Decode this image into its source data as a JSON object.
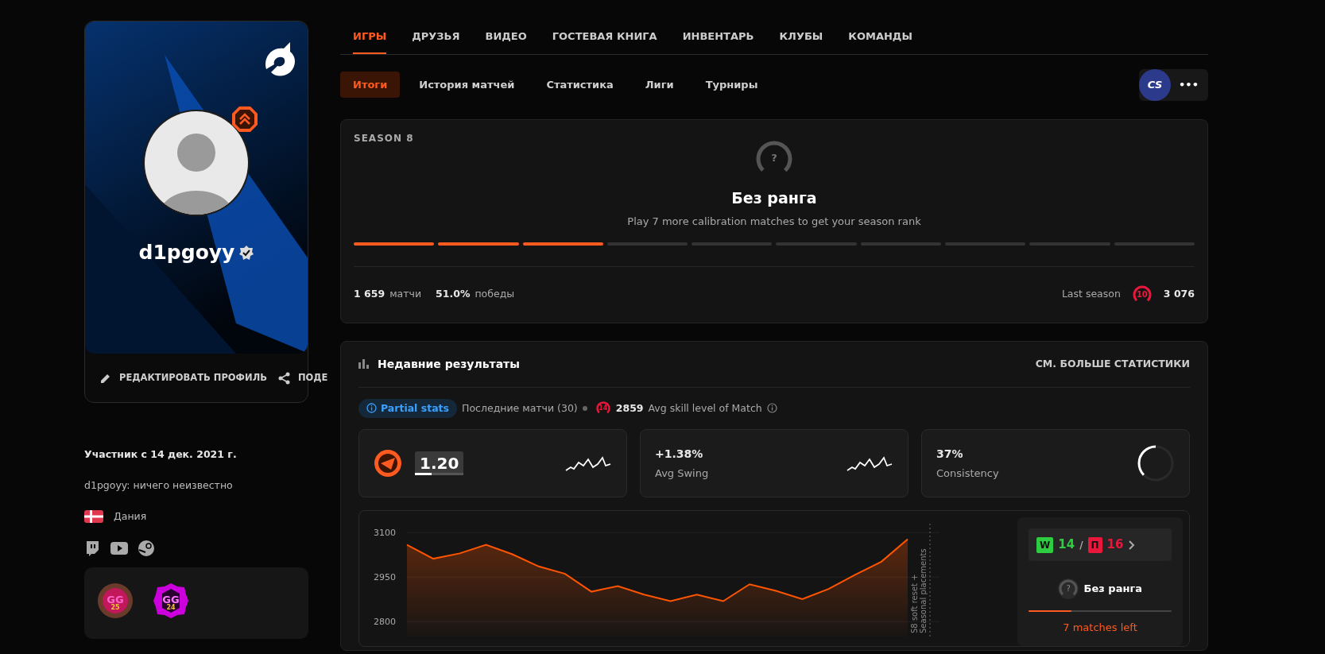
{
  "profile": {
    "nickname": "d1pgoyy",
    "verified": true,
    "actions": [
      {
        "kind": "edit",
        "label": "РЕДАКТИРОВАТЬ ПРОФИЛЬ"
      },
      {
        "kind": "share",
        "label": "ПОДЕ"
      }
    ],
    "member_since": "Участник с 14 дек. 2021 г.",
    "bio": "d1pgoyy: ничего неизвестно",
    "country": "Дания",
    "badges": [
      {
        "label": "GG",
        "year": "25",
        "color": "#c2185b"
      },
      {
        "label": "GG",
        "year": "24",
        "color": "#cc00dd"
      }
    ]
  },
  "tabs": [
    {
      "label": "ИГРЫ",
      "selected": true
    },
    {
      "label": "ДРУЗЬЯ",
      "selected": false
    },
    {
      "label": "ВИДЕО",
      "selected": false
    },
    {
      "label": "ГОСТЕВАЯ КНИГА",
      "selected": false
    },
    {
      "label": "ИНВЕНТАРЬ",
      "selected": false
    },
    {
      "label": "КЛУБЫ",
      "selected": false
    },
    {
      "label": "КОМАНДЫ",
      "selected": false
    }
  ],
  "subtabs": [
    {
      "label": "Итоги",
      "selected": true
    },
    {
      "label": "История матчей",
      "selected": false
    },
    {
      "label": "Статистика",
      "selected": false
    },
    {
      "label": "Лиги",
      "selected": false
    },
    {
      "label": "Турниры",
      "selected": false
    }
  ],
  "game_badge": "CS",
  "more_button": "•••",
  "season": {
    "title": "SEASON 8",
    "rank_icon": "?",
    "rank": "Без ранга",
    "hint": "Play 7 more calibration matches to get your season rank",
    "calibration": [
      {
        "done": true
      },
      {
        "done": true
      },
      {
        "done": true
      },
      {
        "done": false
      },
      {
        "done": false
      },
      {
        "done": false
      },
      {
        "done": false
      },
      {
        "done": false
      },
      {
        "done": false
      },
      {
        "done": false
      }
    ],
    "matches": "1 659",
    "matches_label": "матчи",
    "winrate": "51.0%",
    "winrate_label": "победы",
    "last_season_label": "Last season",
    "last_level": "10",
    "last_elo": "3 076"
  },
  "recent": {
    "title": "Недавние результаты",
    "more": "СМ. БОЛЬШЕ СТАТИСТИКИ",
    "partial": "Partial stats",
    "recent_matches": "Последние матчи (30)",
    "avg_level": "14",
    "avg_elo": "2859",
    "avg_label": "Avg skill level of Match",
    "stats": [
      {
        "kind": "rating",
        "value": "1.20",
        "level": 0.35
      },
      {
        "kind": "swing",
        "value": "+1.38%",
        "label": "Avg Swing"
      },
      {
        "kind": "consistency",
        "value": "37%",
        "label": "Consistency",
        "level": 0.37
      }
    ],
    "chart_data": {
      "type": "area",
      "categories": [
        null,
        null,
        null,
        null,
        null,
        null,
        null,
        null,
        null,
        null,
        null,
        null,
        null,
        null,
        null,
        null,
        null,
        null,
        null,
        null
      ],
      "ylim": [
        2750,
        3130
      ],
      "grid": true,
      "yticks": [
        2800,
        2950,
        3100
      ],
      "series": [
        {
          "color": "#ff5500",
          "values": [
            3059,
            3012,
            3030,
            3059,
            3027,
            2986,
            2961,
            2901,
            2920,
            2891,
            2869,
            2891,
            2869,
            2926,
            2904,
            2876,
            2910,
            2958,
            3002,
            3078
          ]
        }
      ]
    },
    "chart_marker": [
      "S8 soft reset +",
      "Seasonal placements"
    ],
    "side": {
      "win_tag": "W",
      "wins": "14",
      "separator": "/",
      "loss_tag": "П",
      "losses": "16",
      "rank_icon": "?",
      "rank": "Без ранга",
      "level": 0.3,
      "left": "7 matches left"
    }
  }
}
